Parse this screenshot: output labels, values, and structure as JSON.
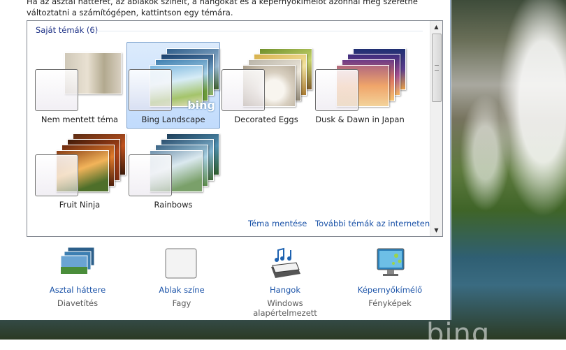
{
  "intro_text": "Ha az asztal hátterét, az ablakok színeit, a hangokat és a képernyőkímélőt azonnal meg szeretné változtatni a számítógépen, kattintson egy témára.",
  "group_title": "Saját témák (6)",
  "themes": [
    {
      "label": "Nem mentett téma",
      "selected": false
    },
    {
      "label": "Bing Landscape",
      "selected": true,
      "logo": "bing"
    },
    {
      "label": "Decorated Eggs",
      "selected": false
    },
    {
      "label": "Dusk & Dawn in Japan",
      "selected": false
    },
    {
      "label": "Fruit Ninja",
      "selected": false
    },
    {
      "label": "Rainbows",
      "selected": false
    }
  ],
  "links": {
    "save_theme": "Téma mentése",
    "more_themes": "További témák az interneten"
  },
  "bottom_items": [
    {
      "title": "Asztal háttere",
      "subtitle": "Diavetítés",
      "icon": "desktop-background-icon"
    },
    {
      "title": "Ablak színe",
      "subtitle": "Fagy",
      "icon": "window-color-icon"
    },
    {
      "title": "Hangok",
      "subtitle": "Windows alapértelmezett",
      "icon": "sounds-icon"
    },
    {
      "title": "Képernyőkímélő",
      "subtitle": "Fényképek",
      "icon": "screensaver-icon"
    }
  ],
  "wallpaper_brand": "bing",
  "colors": {
    "link": "#1b53a8",
    "group_header": "#1e3287",
    "selection": "#c1dbfc"
  }
}
